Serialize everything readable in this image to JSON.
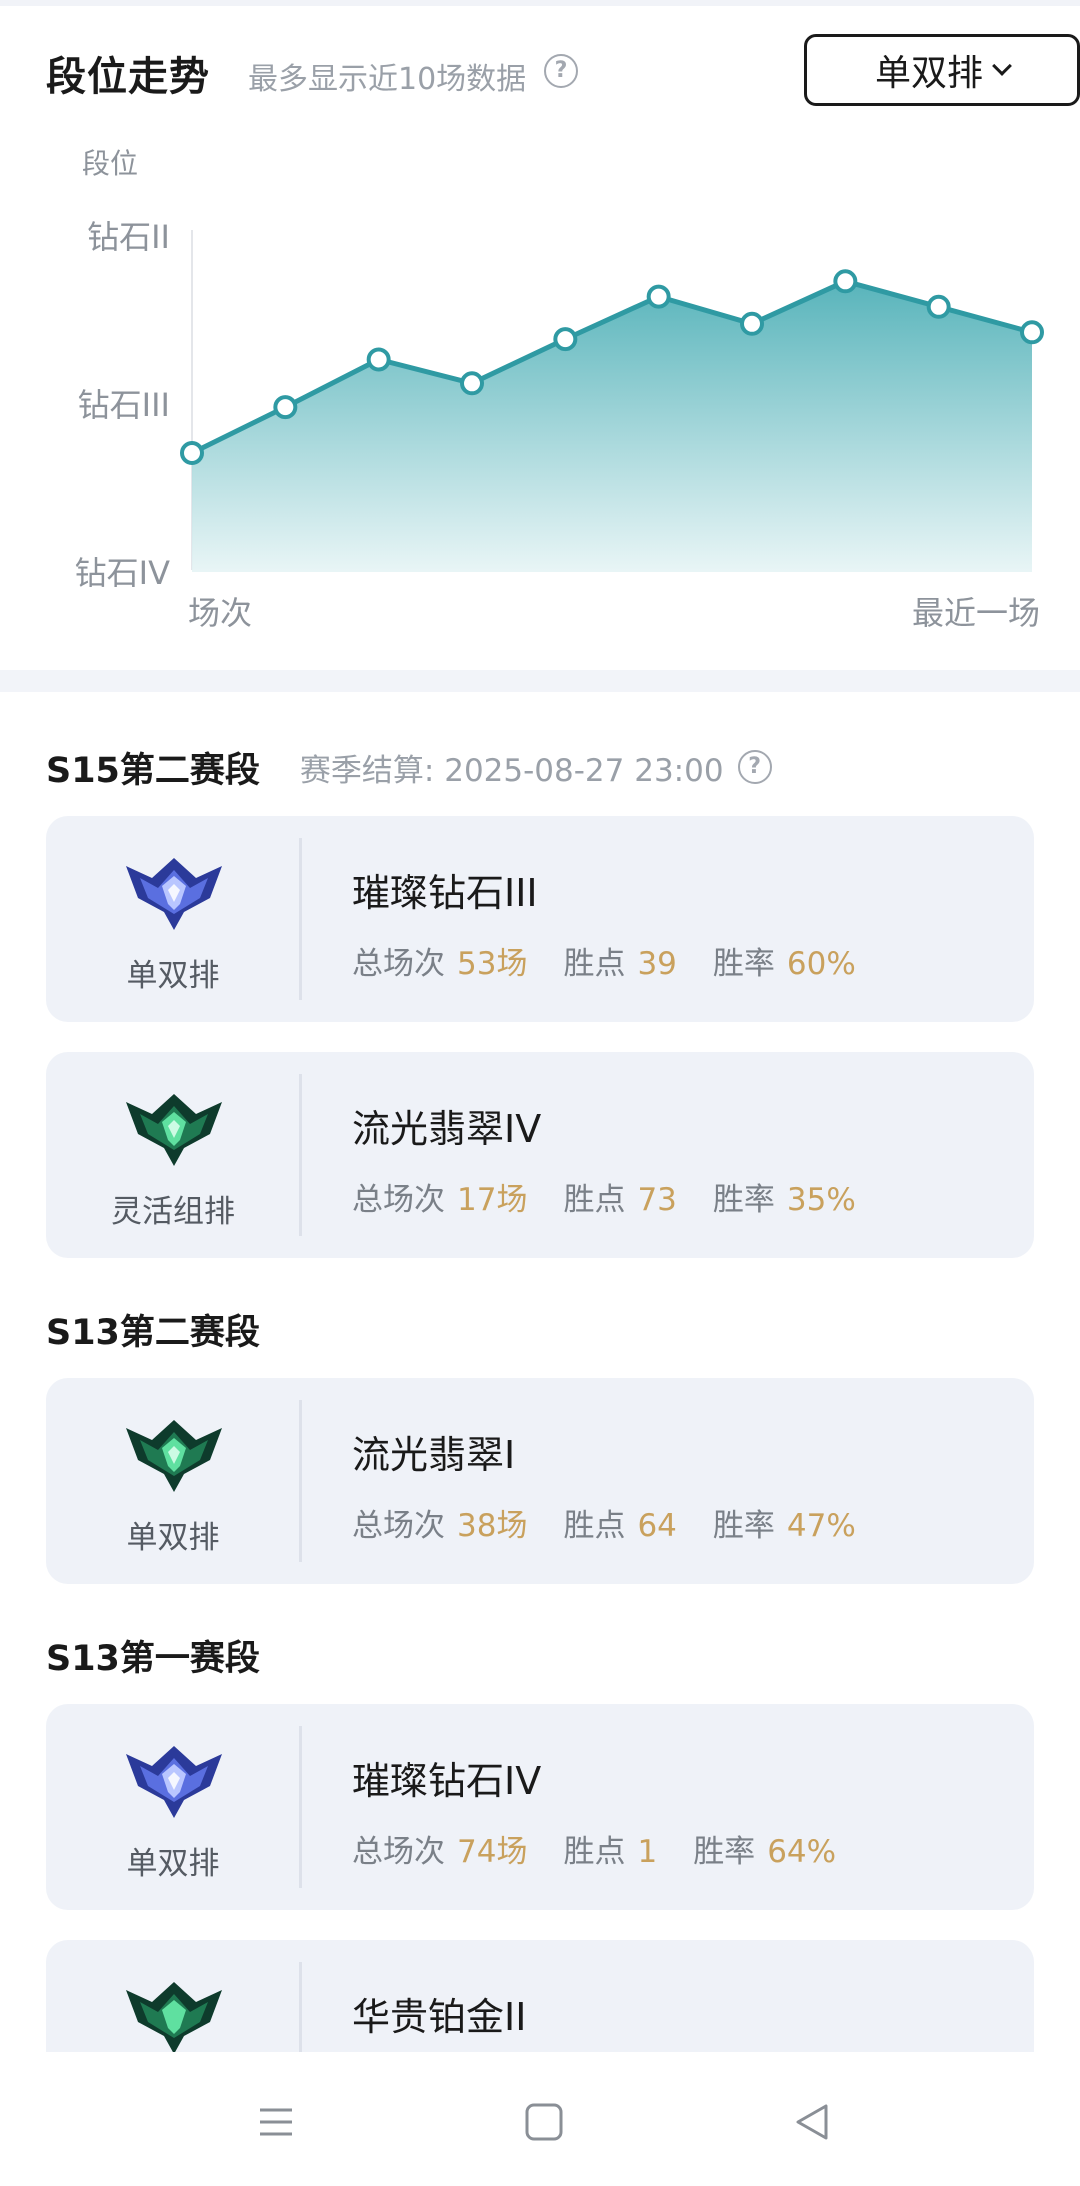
{
  "trend": {
    "title": "段位走势",
    "subtitle": "最多显示近10场数据",
    "help": "?",
    "mode": "单双排"
  },
  "chart_data": {
    "type": "area",
    "ylabel": "段位",
    "ytick_labels": [
      "钻石II",
      "钻石III",
      "钻石IV"
    ],
    "y_axis_levels": {
      "钻石IV": 0,
      "钻石III": 1,
      "钻石II": 2
    },
    "ylim": [
      0,
      2
    ],
    "x_start_label": "场次",
    "x_end_label": "最近一场",
    "values": [
      0.7,
      0.97,
      1.25,
      1.11,
      1.37,
      1.62,
      1.46,
      1.71,
      1.56,
      1.41
    ],
    "color": "#2f9aa3"
  },
  "seasons": [
    {
      "title": "S15第二赛段",
      "subtitle": "赛季结算: 2025-08-27 23:00",
      "help": "?",
      "cards": [
        {
          "emblem": "diamond-emblem-icon",
          "queue": "单双排",
          "rank": "璀璨钻石III",
          "games_label": "总场次",
          "games": "53场",
          "points_label": "胜点",
          "points": "39",
          "winrate_label": "胜率",
          "winrate": "60%"
        },
        {
          "emblem": "emerald-emblem-icon",
          "queue": "灵活组排",
          "rank": "流光翡翠IV",
          "games_label": "总场次",
          "games": "17场",
          "points_label": "胜点",
          "points": "73",
          "winrate_label": "胜率",
          "winrate": "35%"
        }
      ]
    },
    {
      "title": "S13第二赛段",
      "cards": [
        {
          "emblem": "emerald-emblem-icon",
          "queue": "单双排",
          "rank": "流光翡翠I",
          "games_label": "总场次",
          "games": "38场",
          "points_label": "胜点",
          "points": "64",
          "winrate_label": "胜率",
          "winrate": "47%"
        }
      ]
    },
    {
      "title": "S13第一赛段",
      "cards": [
        {
          "emblem": "diamond-emblem-icon",
          "queue": "单双排",
          "rank": "璀璨钻石IV",
          "games_label": "总场次",
          "games": "74场",
          "points_label": "胜点",
          "points": "1",
          "winrate_label": "胜率",
          "winrate": "64%"
        },
        {
          "emblem": "emerald-emblem-icon",
          "queue": "",
          "rank": "华贵铂金II"
        }
      ]
    }
  ],
  "nav": {
    "menu": "menu-icon",
    "home": "home-icon",
    "back": "back-icon"
  }
}
